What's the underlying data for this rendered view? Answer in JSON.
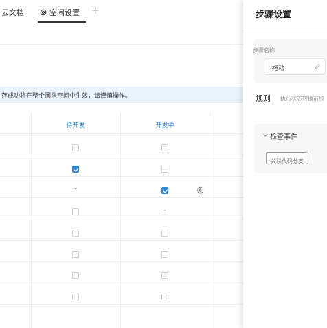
{
  "tabs": [
    {
      "label": "云文档"
    },
    {
      "label": "空间设置",
      "icon": "gear-icon",
      "active": true
    }
  ],
  "add_tab_icon": "plus-icon",
  "notice": "存成功将在整个团队空间中生效，请谨慎操作。",
  "table": {
    "columns": [
      "待开发",
      "开发中"
    ],
    "rows": [
      {
        "c1": "unchecked",
        "c2": "unchecked"
      },
      {
        "c1": "checked",
        "c2": "unchecked"
      },
      {
        "c1": "dash",
        "c2": "checked",
        "gear": true
      },
      {
        "c1": "unchecked",
        "c2": "dash"
      },
      {
        "c1": "unchecked",
        "c2": "unchecked"
      },
      {
        "c1": "unchecked",
        "c2": "unchecked"
      },
      {
        "c1": "unchecked",
        "c2": "unchecked"
      },
      {
        "c1": "unchecked",
        "c2": "unchecked"
      }
    ],
    "dash_symbol": "-"
  },
  "panel": {
    "title": "步骤设置",
    "name_label": "步骤名称",
    "name_value": "拖动",
    "rules_title": "规则",
    "rules_desc": "执行状态转换前校",
    "event_section_title": "检查事件",
    "event_tag": "关联代码分支"
  },
  "colors": {
    "accent": "#2b88d8",
    "notice_bg": "#e9f3fb"
  }
}
